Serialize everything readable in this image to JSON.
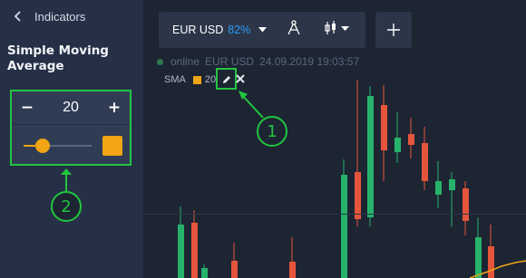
{
  "sidebar": {
    "back_label": "Indicators",
    "title": "Simple Moving Average",
    "period_value": "20",
    "minus_label": "−",
    "plus_label": "+",
    "slider_fraction": 0.23,
    "line_color": "#f0a416"
  },
  "callouts": {
    "one": "1",
    "two": "2",
    "highlight_color": "#22c53f"
  },
  "toolbar": {
    "pair": "EUR USD",
    "payout": "82%",
    "add_label": "+"
  },
  "status": {
    "state": "online",
    "pair": "EUR USD",
    "timestamp": "24.09.2019 19:03:57"
  },
  "indicator": {
    "name": "SMA",
    "period": "20"
  },
  "colors": {
    "bull": "#27b36b",
    "bear": "#e5553b",
    "background": "#1d2533",
    "panel": "#253046",
    "accent_blue": "#2a9cf2"
  },
  "icons": {
    "back": "chevron-left-icon",
    "draw": "compass-icon",
    "candles": "candlestick-icon",
    "edit": "pencil-icon",
    "remove": "close-icon"
  }
}
